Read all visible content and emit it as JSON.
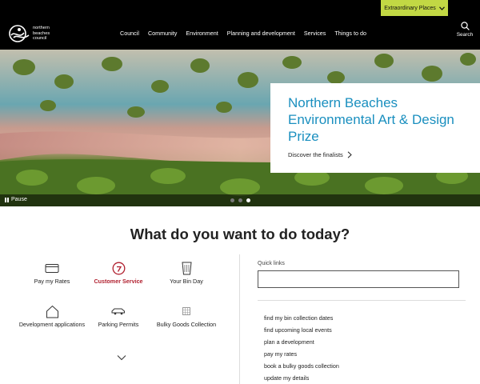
{
  "topbar": {
    "extraordinary_label": "Extraordinary Places",
    "extraordinary_icon": "chevron-down-icon"
  },
  "logo": {
    "line1": "northern",
    "line2": "beaches",
    "line3": "council"
  },
  "nav": {
    "items": [
      {
        "label": "Council"
      },
      {
        "label": "Community"
      },
      {
        "label": "Environment"
      },
      {
        "label": "Planning and development"
      },
      {
        "label": "Services"
      },
      {
        "label": "Things to do"
      }
    ],
    "search_label": "Search",
    "search_icon": "search-icon"
  },
  "hero": {
    "title": "Northern Beaches Environmental Art & Design Prize",
    "link_label": "Discover the finalists",
    "pause_label": "Pause",
    "slide_count": 3,
    "active_slide": 3
  },
  "what_to_do": {
    "title": "What do you want to do today?",
    "tiles": [
      {
        "label": "Pay my Rates",
        "icon": "card-icon"
      },
      {
        "label": "Customer Service",
        "icon": "help-icon"
      },
      {
        "label": "Your Bin Day",
        "icon": "bin-icon"
      },
      {
        "label": "Development applications",
        "icon": "house-icon"
      },
      {
        "label": "Parking Permits",
        "icon": "car-icon"
      },
      {
        "label": "Bulky Goods Collection",
        "icon": "grid-icon"
      }
    ],
    "more_icon": "chevron-down-icon"
  },
  "quick_links": {
    "label": "Quick links",
    "input_value": "",
    "items": [
      "find my bin collection dates",
      "find upcoming local events",
      "plan a development",
      "pay my rates",
      "book a bulky goods collection",
      "update my details"
    ]
  },
  "colors": {
    "accent_blue": "#1a8fbf",
    "accent_red": "#b01f2e",
    "lime": "#c2d844"
  }
}
